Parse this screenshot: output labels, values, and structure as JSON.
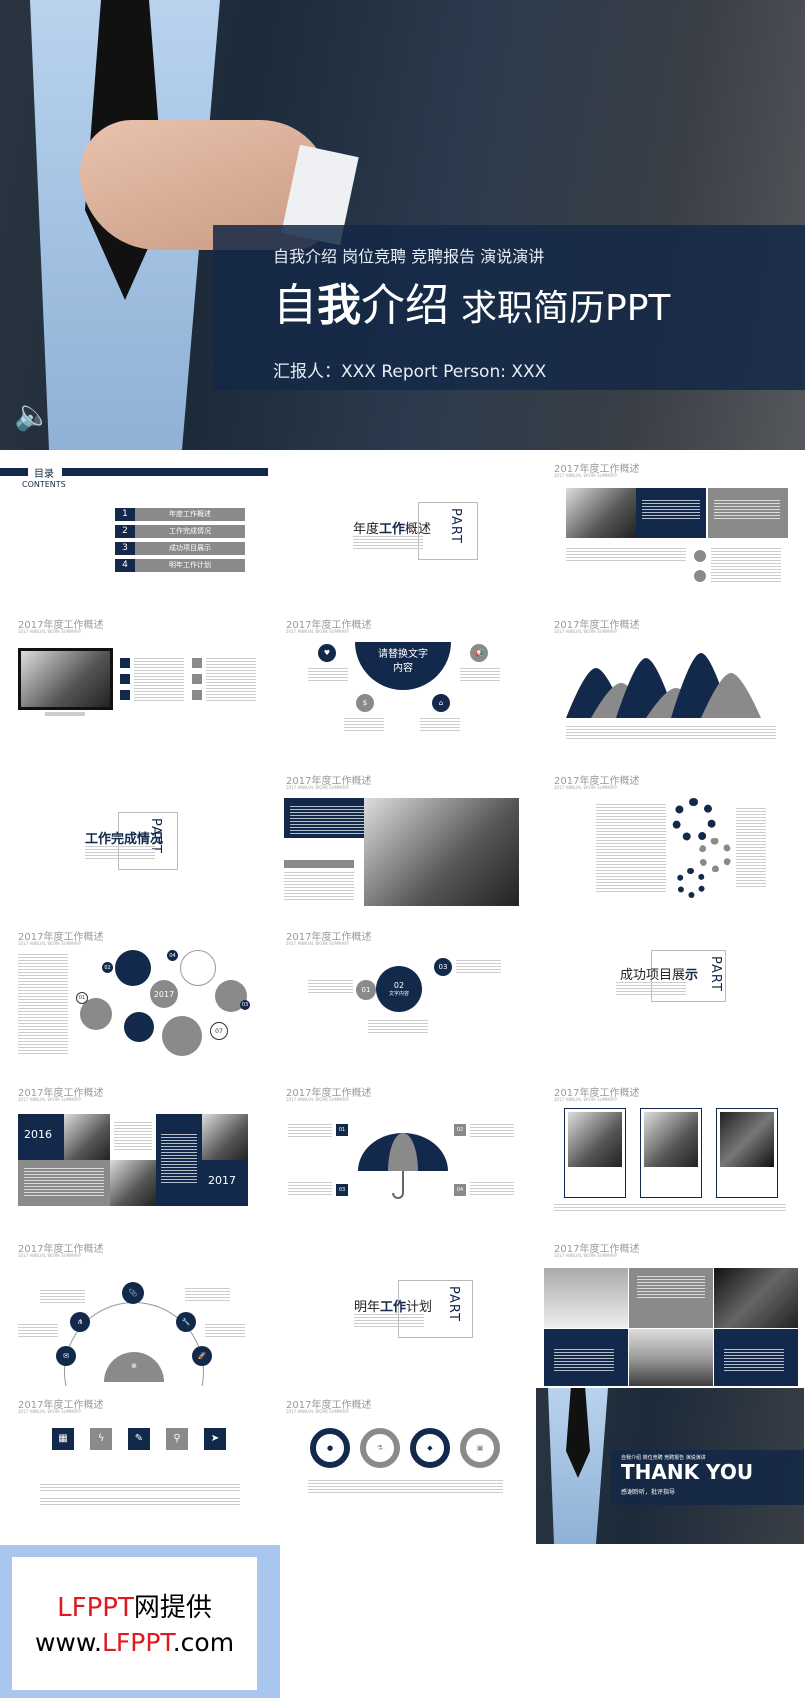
{
  "hero": {
    "subtitle": "自我介绍 岗位竞聘 竞聘报告 演说演讲",
    "title_a": "自",
    "title_b": "我",
    "title_c": "介绍",
    "title_rest": "求职简历PPT",
    "reporter": "汇报人：XXX  Report Person: XXX",
    "speaker_icon": "speaker-icon"
  },
  "common": {
    "slide_title": "2017年度工作概述",
    "slide_sub": "2017 ANNUAL WORK SUMMARY",
    "part": "PART",
    "placeholder": "请替换文字内容"
  },
  "toc": {
    "title": "目录",
    "subtitle": "CONTENTS",
    "items": [
      {
        "num": "1",
        "label": "年度工作概述"
      },
      {
        "num": "2",
        "label": "工作完成情况"
      },
      {
        "num": "3",
        "label": "成功项目展示"
      },
      {
        "num": "4",
        "label": "明年工作计划"
      }
    ]
  },
  "parts": [
    {
      "pre": "年度",
      "bold": "工作",
      "post": "概述"
    },
    {
      "pre": "",
      "bold": "工作",
      "post": "完成情况"
    },
    {
      "pre": "成功项目展",
      "bold": "示",
      "post": ""
    },
    {
      "pre": "明年",
      "bold": "工作",
      "post": "计划"
    }
  ],
  "semicircle": {
    "text": "请替换文字内容"
  },
  "bubbles": {
    "year": "2017",
    "n1": "01",
    "n2": "02",
    "n3": "03",
    "n4": "04",
    "n7": "07"
  },
  "circles": {
    "n1": "01",
    "n2": "02",
    "n3": "03",
    "label": "文字内容"
  },
  "years": {
    "a": "2016",
    "b": "2017"
  },
  "umbrella": {
    "n": [
      "01",
      "02",
      "03",
      "04"
    ]
  },
  "thankyou": {
    "sub": "自我介绍 岗位竞聘 竞聘报告 演说演讲",
    "title": "THANK YOU",
    "line": "感谢聆听，批评指导"
  },
  "footer": {
    "brand": "LFPPT",
    "l1_rest": "网提供",
    "www": "www.",
    "com": ".com"
  },
  "colors": {
    "navy": "#13294b",
    "gray": "#8a8a8a",
    "red": "#e0191e",
    "footer_bg": "#a9c6ee"
  }
}
